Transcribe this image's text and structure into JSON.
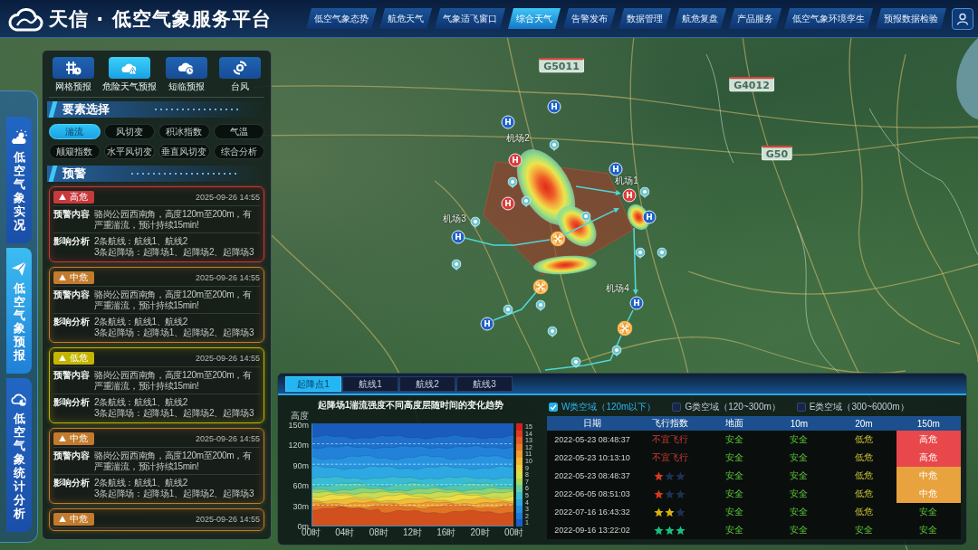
{
  "header": {
    "title": "天信 · 低空气象服务平台",
    "nav": [
      {
        "label": "低空气象态势",
        "selected": false
      },
      {
        "label": "航危天气",
        "selected": false
      },
      {
        "label": "气象适飞窗口",
        "selected": false
      },
      {
        "label": "综合天气",
        "selected": true
      },
      {
        "label": "告警发布",
        "selected": false
      },
      {
        "label": "数据管理",
        "selected": false
      },
      {
        "label": "航危复盘",
        "selected": false
      },
      {
        "label": "产品服务",
        "selected": false
      },
      {
        "label": "低空气象环境孪生",
        "selected": false
      },
      {
        "label": "预报数据检验",
        "selected": false
      }
    ]
  },
  "side_tabs": [
    {
      "label": "低空气象实况",
      "selected": false
    },
    {
      "label": "低空气象预报",
      "selected": true
    },
    {
      "label": "低空气象统计分析",
      "selected": false
    }
  ],
  "left_panel": {
    "modes": [
      {
        "label": "网格预报",
        "selected": false
      },
      {
        "label": "危险天气预报",
        "selected": true
      },
      {
        "label": "短临预报",
        "selected": false
      },
      {
        "label": "台风",
        "selected": false
      }
    ],
    "element_title": "要素选择",
    "elements": [
      {
        "label": "湍流",
        "selected": true
      },
      {
        "label": "风切变",
        "selected": false
      },
      {
        "label": "积冰指数",
        "selected": false
      },
      {
        "label": "气温",
        "selected": false
      },
      {
        "label": "颠簸指数",
        "selected": false
      },
      {
        "label": "水平风切变",
        "selected": false
      },
      {
        "label": "垂直风切变",
        "selected": false
      },
      {
        "label": "综合分析",
        "selected": false
      }
    ],
    "warning_title": "预警",
    "warnings": [
      {
        "badge": "高危",
        "color": "#c8393b",
        "time": "2025-09-26 14:55",
        "content_label": "预警内容",
        "content": "骆岗公园西南角，高度120m至200m，有严重湍流，预计持续15min!",
        "impact_label": "影响分析",
        "impact": [
          "2条航线：航线1、航线2",
          "3条起降场：起降场1、起降场2、起降场3"
        ]
      },
      {
        "badge": "中危",
        "color": "#c27a2c",
        "time": "2025-09-26 14:55",
        "content_label": "预警内容",
        "content": "骆岗公园西南角，高度120m至200m，有严重湍流，预计持续15min!",
        "impact_label": "影响分析",
        "impact": [
          "2条航线：航线1、航线2",
          "3条起降场：起降场1、起降场2、起降场3"
        ]
      },
      {
        "badge": "低危",
        "color": "#c4b400",
        "time": "2025-09-26 14:55",
        "content_label": "预警内容",
        "content": "骆岗公园西南角，高度120m至200m，有严重湍流，预计持续15min!",
        "impact_label": "影响分析",
        "impact": [
          "2条航线：航线1、航线2",
          "3条起降场：起降场1、起降场2、起降场3"
        ]
      },
      {
        "badge": "中危",
        "color": "#c27a2c",
        "time": "2025-09-26 14:55",
        "content_label": "预警内容",
        "content": "骆岗公园西南角，高度120m至200m，有严重湍流，预计持续15min!",
        "impact_label": "影响分析",
        "impact": [
          "2条航线：航线1、航线2",
          "3条起降场：起降场1、起降场2、起降场3"
        ]
      },
      {
        "badge": "中危",
        "color": "#c27a2c",
        "time": "2025-09-26 14:55"
      }
    ]
  },
  "map": {
    "road_signs": [
      "G5011",
      "G4012",
      "G50"
    ],
    "airfield_labels": [
      "机场2",
      "机场1",
      "机场3",
      "机场4"
    ],
    "markers": [
      {
        "kind": "helipad",
        "symbol": "H",
        "alert": false
      },
      {
        "kind": "helipad",
        "symbol": "H",
        "alert": false
      },
      {
        "kind": "helipad",
        "symbol": "H",
        "alert": true
      },
      {
        "kind": "helipad",
        "symbol": "H",
        "alert": false
      },
      {
        "kind": "helipad",
        "symbol": "H",
        "alert": true
      },
      {
        "kind": "helipad",
        "symbol": "H",
        "alert": true
      },
      {
        "kind": "helipad",
        "symbol": "H",
        "alert": false
      },
      {
        "kind": "helipad",
        "symbol": "H",
        "alert": false
      },
      {
        "kind": "helipad",
        "symbol": "H",
        "alert": false
      },
      {
        "kind": "helipad",
        "symbol": "H",
        "alert": false
      },
      {
        "kind": "drone"
      },
      {
        "kind": "drone"
      },
      {
        "kind": "drone"
      },
      {
        "kind": "pin"
      },
      {
        "kind": "pin"
      },
      {
        "kind": "pin"
      },
      {
        "kind": "pin"
      },
      {
        "kind": "pin"
      },
      {
        "kind": "pin"
      },
      {
        "kind": "pin"
      },
      {
        "kind": "pin"
      },
      {
        "kind": "pin"
      },
      {
        "kind": "pin"
      },
      {
        "kind": "pin"
      },
      {
        "kind": "pin"
      },
      {
        "kind": "pin"
      },
      {
        "kind": "pin"
      }
    ]
  },
  "bottom_panel": {
    "tabs": [
      {
        "label": "起降点1",
        "selected": true
      },
      {
        "label": "航线1",
        "selected": false
      },
      {
        "label": "航线2",
        "selected": false
      },
      {
        "label": "航线3",
        "selected": false
      }
    ],
    "chart": {
      "title": "起降场1湍流强度不同高度层随时间的变化趋势",
      "y_label": "高度",
      "y_ticks": [
        "150m",
        "120m",
        "90m",
        "60m",
        "30m",
        "0m"
      ],
      "x_ticks": [
        "00时",
        "04时",
        "08时",
        "12时",
        "16时",
        "20时",
        "00时"
      ],
      "scale_ticks": [
        "15",
        "14",
        "13",
        "12",
        "11",
        "10",
        "9",
        "8",
        "7",
        "6",
        "5",
        "4",
        "3",
        "2",
        "1"
      ]
    },
    "airspace_filters": [
      {
        "label": "W类空域（120m以下）",
        "checked": true
      },
      {
        "label": "G类空域（120~300m）",
        "checked": false
      },
      {
        "label": "E类空域（300~6000m）",
        "checked": false
      }
    ],
    "table": {
      "columns": [
        "日期",
        "飞行指数",
        "地面",
        "10m",
        "20m",
        "150m"
      ],
      "rows": [
        {
          "date": "2022-05-23 08:48:37",
          "index": {
            "kind": "text",
            "text": "不宜飞行"
          },
          "levels": [
            {
              "text": "安全",
              "kind": "safe"
            },
            {
              "text": "安全",
              "kind": "safe"
            },
            {
              "text": "低危",
              "kind": "low"
            },
            {
              "text": "高危",
              "kind": "high"
            }
          ]
        },
        {
          "date": "2022-05-23 10:13:10",
          "index": {
            "kind": "text",
            "text": "不宜飞行"
          },
          "levels": [
            {
              "text": "安全",
              "kind": "safe"
            },
            {
              "text": "安全",
              "kind": "safe"
            },
            {
              "text": "低危",
              "kind": "low"
            },
            {
              "text": "高危",
              "kind": "high"
            }
          ]
        },
        {
          "date": "2022-05-23 08:48:37",
          "index": {
            "kind": "stars",
            "stars": 1
          },
          "levels": [
            {
              "text": "安全",
              "kind": "safe"
            },
            {
              "text": "安全",
              "kind": "safe"
            },
            {
              "text": "低危",
              "kind": "low"
            },
            {
              "text": "中危",
              "kind": "medium"
            }
          ]
        },
        {
          "date": "2022-06-05 08:51:03",
          "index": {
            "kind": "stars",
            "stars": 1
          },
          "levels": [
            {
              "text": "安全",
              "kind": "safe"
            },
            {
              "text": "安全",
              "kind": "safe"
            },
            {
              "text": "低危",
              "kind": "low"
            },
            {
              "text": "中危",
              "kind": "medium"
            }
          ]
        },
        {
          "date": "2022-07-16 16:43:32",
          "index": {
            "kind": "stars",
            "stars": 2
          },
          "levels": [
            {
              "text": "安全",
              "kind": "safe"
            },
            {
              "text": "安全",
              "kind": "safe"
            },
            {
              "text": "低危",
              "kind": "low"
            },
            {
              "text": "安全",
              "kind": "safe"
            }
          ]
        },
        {
          "date": "2022-09-16 13:22:02",
          "index": {
            "kind": "stars",
            "stars": 3
          },
          "levels": [
            {
              "text": "安全",
              "kind": "safe"
            },
            {
              "text": "安全",
              "kind": "safe"
            },
            {
              "text": "安全",
              "kind": "safe"
            },
            {
              "text": "安全",
              "kind": "safe"
            }
          ]
        }
      ]
    }
  }
}
